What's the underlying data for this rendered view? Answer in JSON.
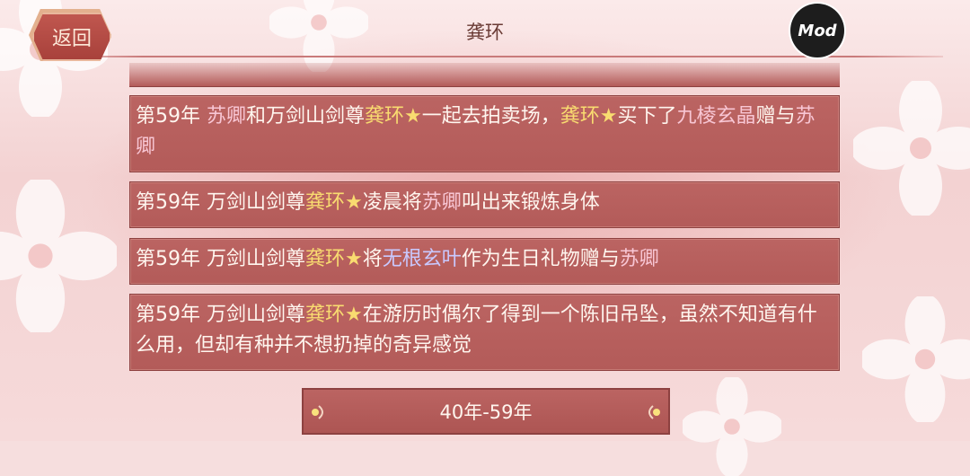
{
  "header": {
    "back_label": "返回",
    "title": "龚环",
    "mod_label": "Mod"
  },
  "entries": [
    {
      "segments": [
        {
          "text": "第59年 ",
          "color": "name"
        },
        {
          "text": "苏卿",
          "color": "pink"
        },
        {
          "text": "和万剑山剑尊",
          "color": "name"
        },
        {
          "text": "龚环★",
          "color": "gold"
        },
        {
          "text": "一起去拍卖场，",
          "color": "name"
        },
        {
          "text": "龚环★",
          "color": "gold"
        },
        {
          "text": "买下了",
          "color": "name"
        },
        {
          "text": "九棱玄晶",
          "color": "pink"
        },
        {
          "text": "赠与",
          "color": "name"
        },
        {
          "text": "苏卿",
          "color": "pink"
        }
      ]
    },
    {
      "segments": [
        {
          "text": "第59年 万剑山剑尊",
          "color": "name"
        },
        {
          "text": "龚环★",
          "color": "gold"
        },
        {
          "text": "凌晨将",
          "color": "name"
        },
        {
          "text": "苏卿",
          "color": "pink"
        },
        {
          "text": "叫出来锻炼身体",
          "color": "name"
        }
      ]
    },
    {
      "segments": [
        {
          "text": "第59年 万剑山剑尊",
          "color": "name"
        },
        {
          "text": "龚环★",
          "color": "gold"
        },
        {
          "text": "将",
          "color": "name"
        },
        {
          "text": "无根玄叶",
          "color": "blue"
        },
        {
          "text": "作为生日礼物赠与",
          "color": "name"
        },
        {
          "text": "苏卿",
          "color": "pink"
        }
      ]
    },
    {
      "segments": [
        {
          "text": "第59年 万剑山剑尊",
          "color": "name"
        },
        {
          "text": "龚环★",
          "color": "gold"
        },
        {
          "text": "在游历时偶尔了得到一个陈旧吊坠，虽然不知道有什么用，但却有种并不想扔掉的奇异感觉",
          "color": "name"
        }
      ]
    }
  ],
  "pager": {
    "range_label": "40年-59年"
  },
  "colors": {
    "panel": "#b35b59",
    "gold_text": "#f9dc70",
    "pink_text": "#f8c6d4",
    "blue_text": "#c9c9ff",
    "button": "#a8413b"
  },
  "icons": {
    "left_arrow": "ornate-left-arrow",
    "right_arrow": "ornate-right-arrow"
  }
}
